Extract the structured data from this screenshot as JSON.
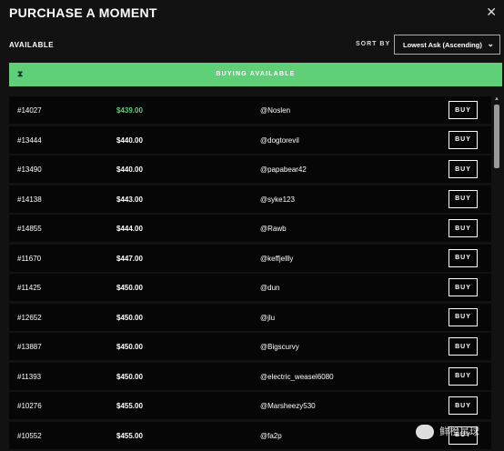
{
  "header": {
    "title": "PURCHASE A MOMENT",
    "close": "✕"
  },
  "available_label": "AVAILABLE",
  "sort": {
    "label": "SORT BY",
    "selected": "Lowest Ask (Ascending)"
  },
  "banner": {
    "text": "BUYING AVAILABLE",
    "icon": "hourglass-icon"
  },
  "buy_label": "BUY",
  "rows": [
    {
      "serial": "#14027",
      "price": "$439.00",
      "user": "@Noslen"
    },
    {
      "serial": "#13444",
      "price": "$440.00",
      "user": "@dogtorevil"
    },
    {
      "serial": "#13490",
      "price": "$440.00",
      "user": "@papabear42"
    },
    {
      "serial": "#14138",
      "price": "$443.00",
      "user": "@syke123"
    },
    {
      "serial": "#14855",
      "price": "$444.00",
      "user": "@Rawb"
    },
    {
      "serial": "#11670",
      "price": "$447.00",
      "user": "@keffjellly"
    },
    {
      "serial": "#11425",
      "price": "$450.00",
      "user": "@dun"
    },
    {
      "serial": "#12652",
      "price": "$450.00",
      "user": "@jlu"
    },
    {
      "serial": "#13887",
      "price": "$450.00",
      "user": "@Bigscurvy"
    },
    {
      "serial": "#11393",
      "price": "$450.00",
      "user": "@electric_weasel6080"
    },
    {
      "serial": "#10276",
      "price": "$455.00",
      "user": "@Marsheezy530"
    },
    {
      "serial": "#10552",
      "price": "$455.00",
      "user": "@fa2p"
    }
  ],
  "watermark": "鲜橙星球",
  "colors": {
    "accent": "#5fcf78",
    "background": "#121212",
    "row": "#060606"
  }
}
